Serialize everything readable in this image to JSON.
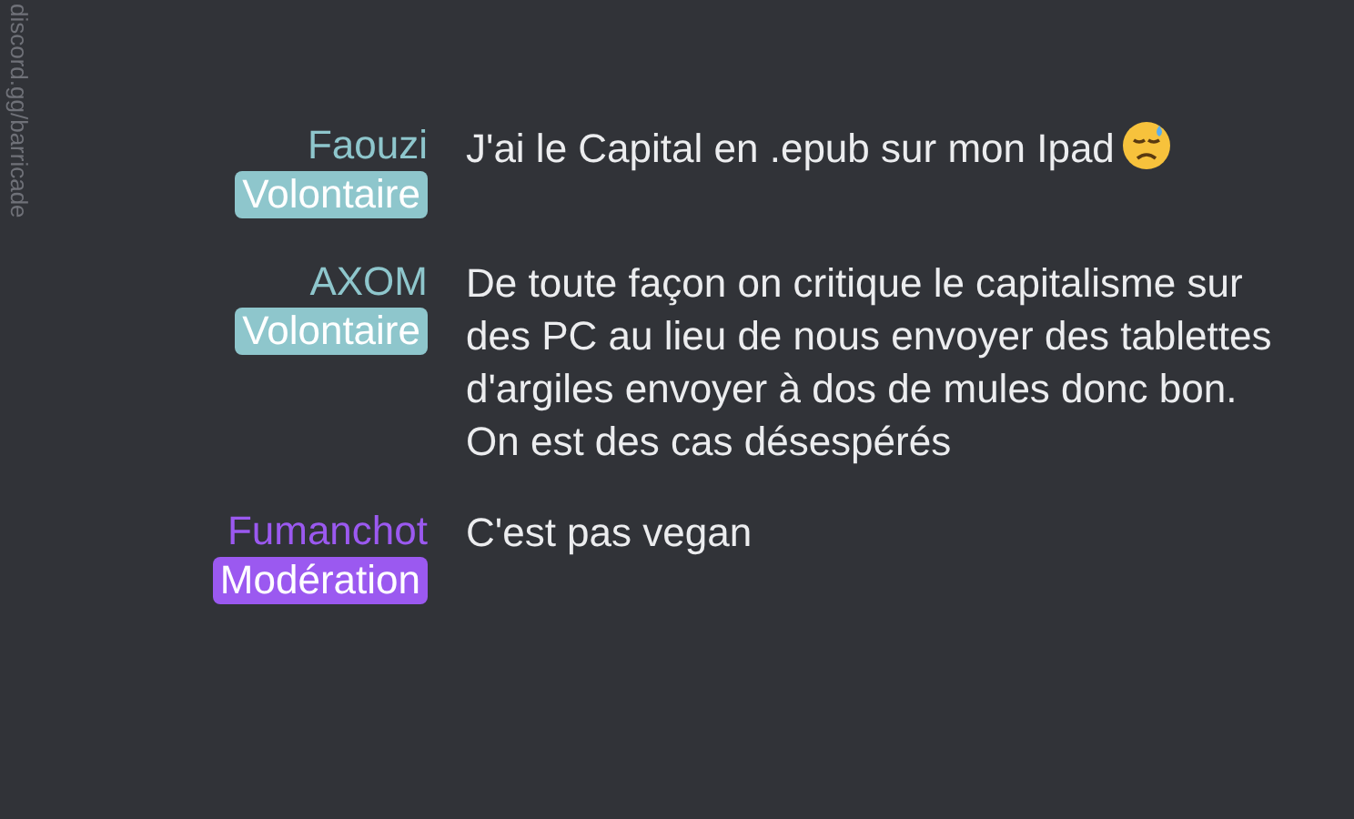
{
  "side_label": "discord.gg/barricade",
  "messages": [
    {
      "author": "Faouzi",
      "role": "Volontaire",
      "color": "#8ec6cc",
      "text": "J'ai le Capital en .epub sur mon Ipad",
      "emoji": true
    },
    {
      "author": "AXOM",
      "role": "Volontaire",
      "color": "#8ec6cc",
      "text": "De toute façon on critique le capitalisme sur des PC au lieu de nous envoyer des tablettes d'argiles envoyer à dos de mules donc bon. On est des cas désespérés",
      "emoji": false
    },
    {
      "author": "Fumanchot",
      "role": "Modération",
      "color": "#9b59f0",
      "text": "C'est pas vegan",
      "emoji": false
    }
  ]
}
